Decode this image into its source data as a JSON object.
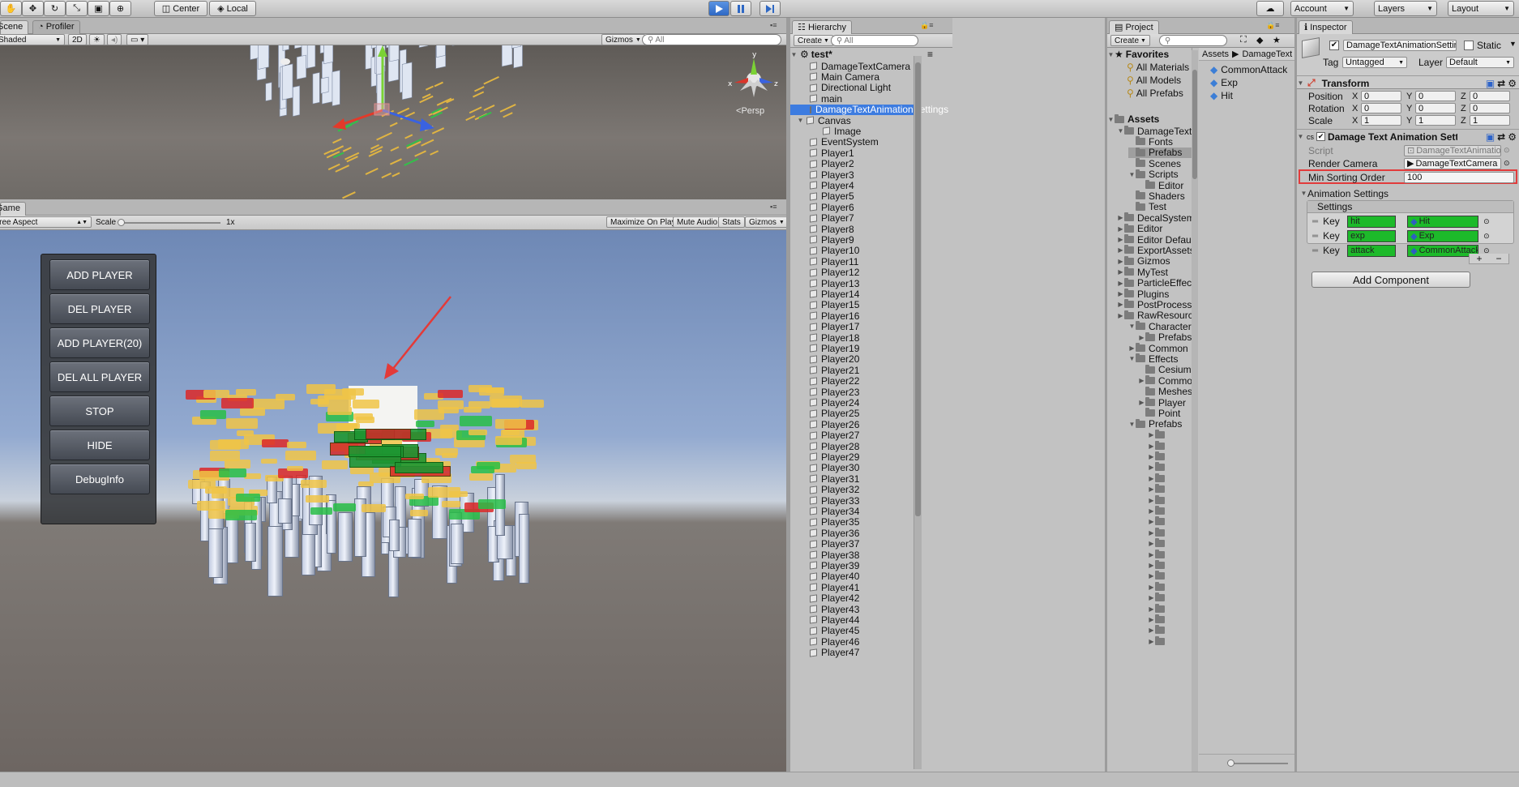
{
  "toolbar": {
    "tools": [
      "hand",
      "move",
      "rotate",
      "scale",
      "rect",
      "transform"
    ],
    "pivot_label": "Center",
    "space_label": "Local",
    "account_label": "Account",
    "layers_label": "Layers",
    "layout_label": "Layout",
    "accent_color": "#3a7bdc"
  },
  "scene": {
    "tab_label": "Scene",
    "profiler_tab_label": "Profiler",
    "shading_mode": "Shaded",
    "mode_2d": "2D",
    "gizmos_label": "Gizmos",
    "search_placeholder": "All",
    "persp_label": "Persp"
  },
  "game": {
    "tab_label": "Game",
    "aspect_label": "Free Aspect",
    "scale_label": "Scale",
    "scale_value": "1x",
    "maximize_on_play": "Maximize On Play",
    "mute_audio": "Mute Audio",
    "stats": "Stats",
    "gizmos": "Gizmos",
    "buttons": [
      "ADD PLAYER",
      "DEL PLAYER",
      "ADD PLAYER(20)",
      "DEL ALL PLAYER",
      "STOP",
      "HIDE",
      "DebugInfo"
    ]
  },
  "hierarchy": {
    "tab_label": "Hierarchy",
    "create_label": "Create",
    "search_placeholder": "All",
    "scene_name": "test*",
    "items": [
      "DamageTextCamera",
      "Main Camera",
      "Directional Light",
      "main",
      "DamageTextAnimationSettings",
      "Canvas",
      "Image",
      "EventSystem",
      "Player1",
      "Player2",
      "Player3",
      "Player4",
      "Player5",
      "Player6",
      "Player7",
      "Player8",
      "Player9",
      "Player10",
      "Player11",
      "Player12",
      "Player13",
      "Player14",
      "Player15",
      "Player16",
      "Player17",
      "Player18",
      "Player19",
      "Player20",
      "Player21",
      "Player22",
      "Player23",
      "Player24",
      "Player25",
      "Player26",
      "Player27",
      "Player28",
      "Player29",
      "Player30",
      "Player31",
      "Player32",
      "Player33",
      "Player34",
      "Player35",
      "Player36",
      "Player37",
      "Player38",
      "Player39",
      "Player40",
      "Player41",
      "Player42",
      "Player43",
      "Player44",
      "Player45",
      "Player46",
      "Player47"
    ],
    "selected_index": 4
  },
  "project": {
    "tab_label": "Project",
    "create_label": "Create",
    "favorites_label": "Favorites",
    "favorites": [
      "All Materials",
      "All Models",
      "All Prefabs"
    ],
    "assets_label": "Assets",
    "tree": [
      "DamageText",
      "Fonts",
      "Prefabs",
      "Scenes",
      "Scripts",
      "Editor",
      "Shaders",
      "Test",
      "DecalSystem",
      "Editor",
      "Editor Default",
      "ExportAssets",
      "Gizmos",
      "MyTest",
      "ParticleEffect",
      "Plugins",
      "PostProcessing",
      "RawResources",
      "Characters",
      "Prefabs",
      "Common",
      "Effects",
      "Cesium",
      "Common",
      "Meshes",
      "Player",
      "Point",
      "Prefabs"
    ],
    "breadcrumb": [
      "Assets",
      "DamageText"
    ],
    "assets": [
      "CommonAttack",
      "Exp",
      "Hit"
    ]
  },
  "inspector": {
    "tab_label": "Inspector",
    "object_name": "DamageTextAnimationSettings",
    "static_label": "Static",
    "tag_label": "Tag",
    "tag_value": "Untagged",
    "layer_label": "Layer",
    "layer_value": "Default",
    "transform": {
      "title": "Transform",
      "position_label": "Position",
      "rotation_label": "Rotation",
      "scale_label": "Scale",
      "position": [
        "0",
        "0",
        "0"
      ],
      "rotation": [
        "0",
        "0",
        "0"
      ],
      "scale": [
        "1",
        "1",
        "1"
      ]
    },
    "component": {
      "title": "Damage Text Animation Settings",
      "script_label": "Script",
      "script_value": "DamageTextAnimationSettings",
      "render_camera_label": "Render Camera",
      "render_camera_value": "DamageTextCamera",
      "min_sorting_order_label": "Min Sorting Order",
      "min_sorting_order_value": "100",
      "highlight_color": "#e23b3b"
    },
    "animation_settings": {
      "title": "Animation Settings",
      "settings_header": "Settings",
      "key_label": "Key",
      "rows": [
        {
          "key": "hit",
          "value": "Hit"
        },
        {
          "key": "exp",
          "value": "Exp"
        },
        {
          "key": "attack",
          "value": "CommonAttack"
        }
      ],
      "field_color": "#1dba2a"
    },
    "add_component_label": "Add Component"
  }
}
